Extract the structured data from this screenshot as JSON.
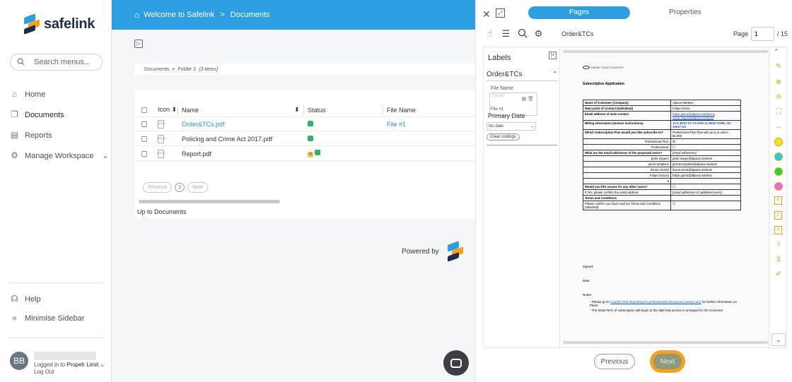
{
  "app": {
    "logo_text": "safelink"
  },
  "sidebar": {
    "search_placeholder": "Search menus...",
    "items": [
      {
        "label": "Home"
      },
      {
        "label": "Documents"
      },
      {
        "label": "Reports"
      },
      {
        "label": "Manage Workspace"
      }
    ],
    "help": "Help",
    "minimise": "Minimise Sidebar",
    "user": {
      "initials": "BB",
      "logged_in_prefix": "Logged in to",
      "org": "Propelr Limit",
      "logout": "Log Out"
    }
  },
  "header": {
    "welcome": "Welcome to Safelink",
    "sep": ">",
    "section": "Documents"
  },
  "breadcrumb": {
    "root": "Documents",
    "sep": ">",
    "folder": "Folder 2",
    "count": "(3 items)"
  },
  "table": {
    "headers": {
      "icon": "Icon",
      "name": "Name",
      "status": "Status",
      "file": "File Name"
    },
    "rows": [
      {
        "name": "Order&TCs.pdf",
        "file": "File #1",
        "statuses": [
          "green"
        ]
      },
      {
        "name": "Policing and Crime Act 2017.pdf",
        "file": "",
        "statuses": [
          "green"
        ]
      },
      {
        "name": "Report.pdf",
        "file": "",
        "statuses": [
          "yellow",
          "green"
        ]
      }
    ],
    "pdf_icon_label": "PDF"
  },
  "pager": {
    "previous": "Previous",
    "page": "1",
    "next": "Next"
  },
  "up_to": "Up to Documents",
  "powered_by": "Powered by",
  "viewer": {
    "tabs": {
      "pages": "Pages",
      "properties": "Properties"
    },
    "doc_title": "Order&TCs",
    "page_label": "Page",
    "page_value": "1",
    "page_total": "/ 15",
    "labels": {
      "title": "Labels",
      "section": "Order&TCs",
      "file_name_label": "File Name",
      "file_name_placeholder": "7/1000",
      "file_name_value": "File #1",
      "primary_date": "Primary Date",
      "date_value": "No date",
      "clear": "Clear codings"
    },
    "doc": {
      "brand": "KNOW YOUR COUNTRY",
      "heading": "Subscription Application",
      "rows": [
        {
          "l": "Name of Customer (Company)",
          "r": "Alpaca Markets",
          "bold": true
        },
        {
          "l": "Main point of Contact (Individual)",
          "r": "Felipe Garza",
          "bold": true
        },
        {
          "l": "Email address of main contact",
          "r": "felipe.garza@alpaca.markets & oscar.segura@alpaca.markets",
          "bold": true
        },
        {
          "l": "Billing Information (Invoice instructions)",
          "r": "12 E 49TH ST. FLOOR 11 NEW YORK, NY 10017 US",
          "bold": true
        },
        {
          "l": "Which Subscription Plan would you like subscribe to?",
          "r": "Professional Plus Plan with up to 5 users - $4,000",
          "bold": true
        },
        {
          "l": "Professional Plus:",
          "r": "☒",
          "bold": false
        },
        {
          "l": "Professional:",
          "r": "☐",
          "bold": false
        },
        {
          "l": "What are the email addresses of the proposed users?",
          "r": "[email addresses]",
          "bold": true
        },
        {
          "l": "peter singer1",
          "r": "peter.singer@alpaca.markets",
          "bold": false
        },
        {
          "l": "jarred tompkins",
          "r": "jarred.tompkins@alpaca.markets",
          "bold": false
        },
        {
          "l": "Bruna Vieira3",
          "r": "bruna.vieira@alpaca.markets",
          "bold": false
        },
        {
          "l": "Felipe Garza4",
          "r": "felipe.garza@alpaca.markets",
          "bold": false
        },
        {
          "l": "5",
          "r": "",
          "bold": false
        },
        {
          "l": "Would you like access for any other users?",
          "r": "☐",
          "bold": true
        },
        {
          "l": "If Yes, please confirm the email address",
          "r": "[email addresses of additional users]",
          "bold": false
        },
        {
          "l": "Terms and Conditions",
          "r": "",
          "bold": true
        },
        {
          "l": "Please confirm you have read our Terms and Conditions (attached)",
          "r": "☐",
          "bold": false
        }
      ],
      "signed": "Signed:",
      "date": "Date:",
      "notes": "Notes:",
      "note1_a": "Please go to",
      "note1_link": "Country Risk Reporting for professionals (knowyourcountry.com)",
      "note1_b": "for further information on Plans.",
      "note2": "The Initial Term of subscription will begin at the date that access is arranged for the Customer"
    },
    "tools": {
      "r1": "R",
      "e": "E",
      "r2": "R"
    },
    "nav": {
      "previous": "Previous",
      "next": "Next"
    }
  },
  "colors": {
    "brand_blue": "#2d9fe0",
    "accent_orange": "#f6a21e",
    "status_green": "#2eb36b",
    "status_yellow": "#f2c94c"
  }
}
